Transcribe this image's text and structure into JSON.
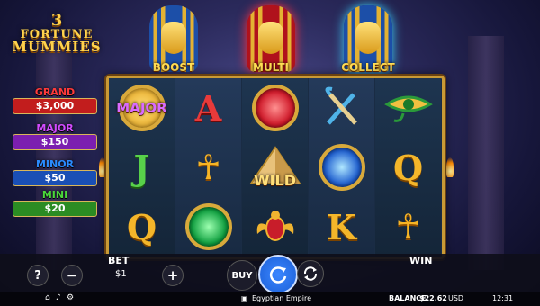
{
  "logo": {
    "line1": "3",
    "line2": "FORTUNE",
    "line3": "MUMMIES"
  },
  "features": [
    {
      "label": "BOOST"
    },
    {
      "label": "MULTI"
    },
    {
      "label": "COLLECT"
    }
  ],
  "jackpots": [
    {
      "name": "GRAND",
      "value": "$3,000",
      "name_color": "#ff3a3a",
      "bg": "#c21d1d"
    },
    {
      "name": "MAJOR",
      "value": "$150",
      "name_color": "#d24bff",
      "bg": "#7b1fb0"
    },
    {
      "name": "MINOR",
      "value": "$50",
      "name_color": "#2a8cff",
      "bg": "#1a4fb5"
    },
    {
      "name": "MINI",
      "value": "$20",
      "name_color": "#4bd83b",
      "bg": "#2b8c23"
    }
  ],
  "reels": {
    "major_badge": "MAJOR",
    "wild_label": "WILD"
  },
  "controls": {
    "help": "?",
    "minus": "−",
    "bet_label": "BET",
    "bet_value": "$1",
    "plus": "+",
    "buy": "BUY",
    "win_label": "WIN"
  },
  "status_bar": {
    "game_name": "Egyptian Empire",
    "balance_label": "BALANCE:",
    "balance_value": "$22.62",
    "currency": "USD",
    "time": "12:31"
  },
  "colors": {
    "gold": "#d8a93b",
    "accent_blue": "#1b5fd6"
  }
}
